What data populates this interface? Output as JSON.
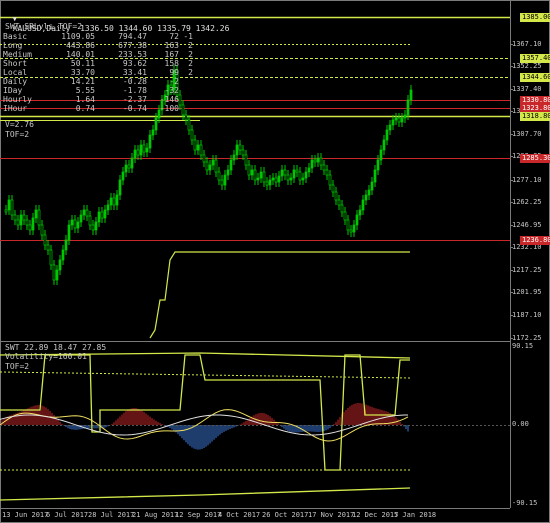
{
  "window": {
    "symbol_line": "XAUUSD,Daily  1336.50 1344.60 1335.79 1342.26"
  },
  "main_panel": {
    "indicator_title": "SWT_SRLvls_TOF=2",
    "table_rows": [
      [
        "Basic",
        "1109.05",
        "794.47",
        "72",
        "-1"
      ],
      [
        "Long",
        "443.86",
        "677.38",
        "163",
        "2"
      ],
      [
        "Medium",
        "140.01",
        "233.53",
        "167",
        "2"
      ],
      [
        "Short",
        "50.11",
        "93.62",
        "158",
        "2"
      ],
      [
        "Local",
        "33.70",
        "33.41",
        "99",
        "2"
      ],
      [
        "Daily",
        "14.21",
        "-0.28",
        "-2",
        ""
      ],
      [
        "IDay",
        "5.55",
        "-1.78",
        "-32",
        ""
      ],
      [
        "Hourly",
        "1.64",
        "-2.37",
        "-146",
        ""
      ],
      [
        "IHour",
        "0.74",
        "-0.74",
        "-100",
        ""
      ]
    ],
    "v_label": "V=2.76",
    "tof_label": "TOF=2",
    "price_axis": [
      "1367.10",
      "1352.25",
      "1337.40",
      "1322.55",
      "1307.70",
      "1292.85",
      "1277.10",
      "1262.25",
      "1246.95",
      "1232.10",
      "1217.25",
      "1201.95",
      "1187.10",
      "1172.25"
    ],
    "price_tags": [
      {
        "label": "1385.00",
        "color": "#d4e84a",
        "text": "#000"
      },
      {
        "label": "1357.40",
        "color": "#d4e84a",
        "text": "#000"
      },
      {
        "label": "1344.60",
        "color": "#d4e84a",
        "text": "#000"
      },
      {
        "label": "1330.80",
        "color": "#c8282a",
        "text": "#fff"
      },
      {
        "label": "1323.80",
        "color": "#c8282a",
        "text": "#fff"
      },
      {
        "label": "1318.80",
        "color": "#d4e84a",
        "text": "#000"
      },
      {
        "label": "1285.30",
        "color": "#c8282a",
        "text": "#fff"
      },
      {
        "label": "1236.80",
        "color": "#c8282a",
        "text": "#fff"
      }
    ]
  },
  "sub_panel": {
    "title": "SWT 22.89 18.47 27.85",
    "volatility_label": "Volatility=160.01",
    "tof_label": "TOF=2",
    "axis": [
      "90.15",
      "0.00",
      "-90.15"
    ]
  },
  "time_axis": [
    "13 Jun 2017",
    "6 Jul 2017",
    "28 Jul 2017",
    "21 Aug 2017",
    "12 Sep 2017",
    "4 Oct 2017",
    "26 Oct 2017",
    "17 Nov 2017",
    "12 Dec 2017",
    "5 Jan 2018"
  ],
  "colors": {
    "bull_candle": "#00c800",
    "bear_candle": "#00c800",
    "yellow_line": "#d4e84a",
    "red_line": "#c8282a",
    "bg": "#000000"
  }
}
